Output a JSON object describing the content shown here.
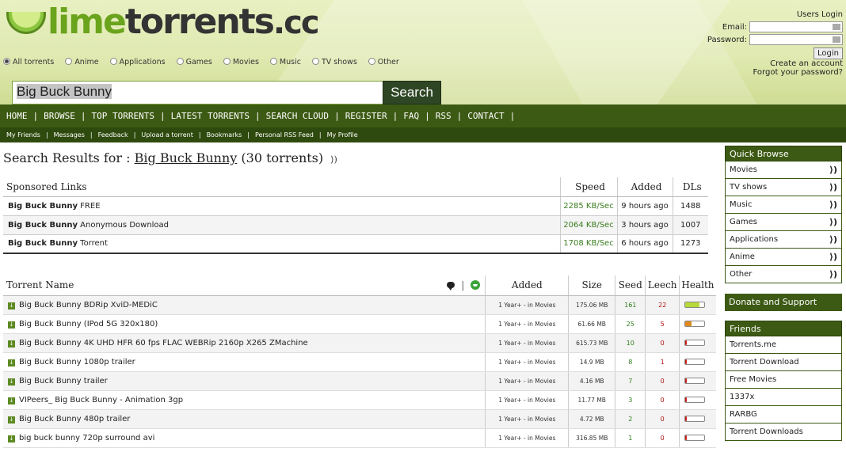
{
  "logo": {
    "part1": "lime",
    "part2": "torrents",
    "part3": ".cc"
  },
  "categories": [
    {
      "label": "All torrents",
      "selected": true
    },
    {
      "label": "Anime",
      "selected": false
    },
    {
      "label": "Applications",
      "selected": false
    },
    {
      "label": "Games",
      "selected": false
    },
    {
      "label": "Movies",
      "selected": false
    },
    {
      "label": "Music",
      "selected": false
    },
    {
      "label": "TV shows",
      "selected": false
    },
    {
      "label": "Other",
      "selected": false
    }
  ],
  "search": {
    "value": "Big Buck Bunny",
    "button": "Search"
  },
  "login": {
    "title": "Users Login",
    "email_label": "Email:",
    "password_label": "Password:",
    "button": "Login",
    "create": "Create an account",
    "forgot": "Forgot your password?"
  },
  "nav": [
    "HOME",
    "BROWSE",
    "TOP TORRENTS",
    "LATEST TORRENTS",
    "SEARCH CLOUD",
    "REGISTER",
    "FAQ",
    "RSS",
    "CONTACT"
  ],
  "subnav": [
    "My Friends",
    "Messages",
    "Feedback",
    "Upload a torrent",
    "Bookmarks",
    "Personal RSS Feed",
    "My Profile"
  ],
  "results": {
    "prefix": "Search Results for : ",
    "query": "Big Buck Bunny",
    "count": "(30 torrents)"
  },
  "sponsored": {
    "headers": {
      "name": "Sponsored Links",
      "speed": "Speed",
      "added": "Added",
      "dls": "DLs"
    },
    "rows": [
      {
        "bold": "Big Buck Bunny",
        "rest": " FREE",
        "speed": "2285 KB/Sec",
        "added": "9 hours ago",
        "dls": "1488"
      },
      {
        "bold": "Big Buck Bunny",
        "rest": " Anonymous Download",
        "speed": "2064 KB/Sec",
        "added": "3 hours ago",
        "dls": "1007"
      },
      {
        "bold": "Big Buck Bunny",
        "rest": " Torrent",
        "speed": "1708 KB/Sec",
        "added": "6 hours ago",
        "dls": "1273"
      }
    ]
  },
  "torrents": {
    "headers": {
      "name": "Torrent Name",
      "added": "Added",
      "size": "Size",
      "seed": "Seed",
      "leech": "Leech",
      "health": "Health"
    },
    "rows": [
      {
        "name": "Big Buck Bunny BDRip XviD-MEDiC",
        "added": "1 Year+ - in Movies",
        "size": "175.06 MB",
        "seed": "161",
        "leech": "22",
        "health": 0.75,
        "health_color": "#b8d93a"
      },
      {
        "name": "Big Buck Bunny (IPod 5G 320x180)",
        "added": "1 Year+ - in Movies",
        "size": "61.66 MB",
        "seed": "25",
        "leech": "5",
        "health": 0.35,
        "health_color": "#e08a1e"
      },
      {
        "name": "Big Buck Bunny 4K UHD HFR 60 fps FLAC WEBRip 2160p X265 ZMachine",
        "added": "1 Year+ - in Movies",
        "size": "615.73 MB",
        "seed": "10",
        "leech": "0",
        "health": 0.1,
        "health_color": "#c8201a"
      },
      {
        "name": "Big Buck Bunny 1080p trailer",
        "added": "1 Year+ - in Movies",
        "size": "14.9 MB",
        "seed": "8",
        "leech": "1",
        "health": 0.1,
        "health_color": "#c8201a"
      },
      {
        "name": "Big Buck Bunny trailer",
        "added": "1 Year+ - in Movies",
        "size": "4.16 MB",
        "seed": "7",
        "leech": "0",
        "health": 0.1,
        "health_color": "#c8201a"
      },
      {
        "name": "VIPeers_ Big Buck Bunny - Animation 3gp",
        "added": "1 Year+ - in Movies",
        "size": "11.77 MB",
        "seed": "3",
        "leech": "0",
        "health": 0.1,
        "health_color": "#c8201a"
      },
      {
        "name": "Big Buck Bunny 480p trailer",
        "added": "1 Year+ - in Movies",
        "size": "4.72 MB",
        "seed": "2",
        "leech": "0",
        "health": 0.1,
        "health_color": "#c8201a"
      },
      {
        "name": "big buck bunny 720p surround avi",
        "added": "1 Year+ - in Movies",
        "size": "316.85 MB",
        "seed": "1",
        "leech": "0",
        "health": 0.1,
        "health_color": "#c8201a"
      }
    ]
  },
  "quick_browse": {
    "title": "Quick Browse",
    "items": [
      "Movies",
      "TV shows",
      "Music",
      "Games",
      "Applications",
      "Anime",
      "Other"
    ]
  },
  "donate": "Donate and Support",
  "friends": {
    "title": "Friends",
    "items": [
      "Torrents.me",
      "Torrent Download",
      "Free Movies",
      "1337x",
      "RARBG",
      "Torrent Downloads"
    ]
  },
  "icons": {
    "rss": "rss-icon",
    "download": "download-icon",
    "comment": "comment-icon",
    "smile": "smile-icon"
  }
}
